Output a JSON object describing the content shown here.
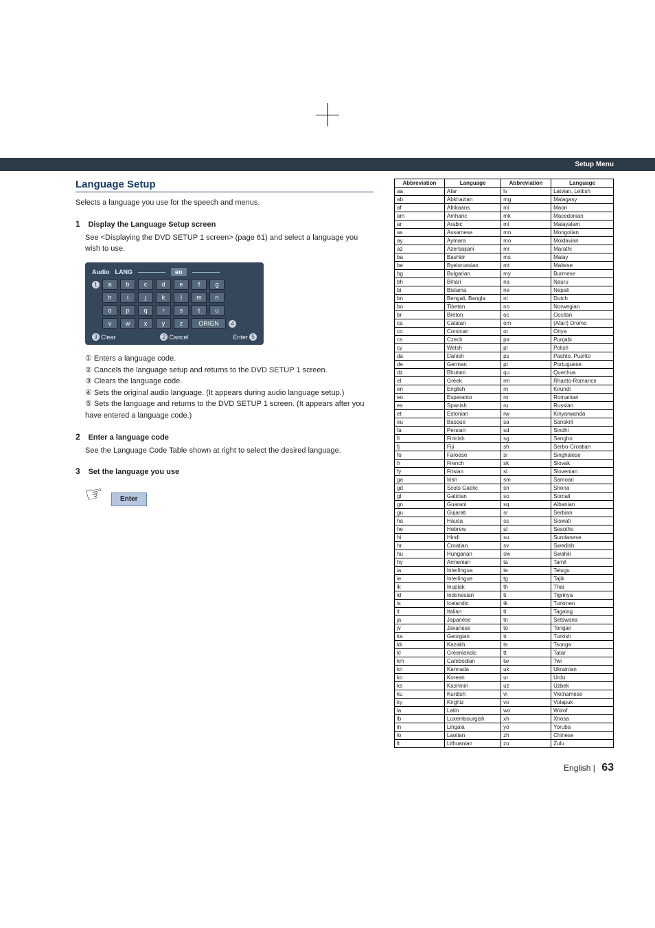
{
  "header_band": "Setup Menu",
  "section_title": "Language Setup",
  "intro": "Selects a language you use for the speech and menus.",
  "steps": {
    "1": {
      "title": "Display the Language Setup screen",
      "body": "See <Displaying the DVD SETUP 1 screen> (page 61) and select a language you wish to use."
    },
    "2": {
      "title": "Enter a language code",
      "body": "See the Language Code Table shown at right to select the desired language."
    },
    "3": {
      "title": "Set the language you use"
    }
  },
  "osd": {
    "title_left": "Audio",
    "title_right": "LANG",
    "en_badge": "en",
    "rows": [
      [
        "a",
        "b",
        "c",
        "d",
        "e",
        "f",
        "g"
      ],
      [
        "h",
        "i",
        "j",
        "k",
        "l",
        "m",
        "n"
      ],
      [
        "o",
        "p",
        "q",
        "r",
        "s",
        "t",
        "u"
      ],
      [
        "v",
        "w",
        "x",
        "y",
        "z",
        "ORIGN"
      ]
    ],
    "bottom": {
      "clear": "Clear",
      "cancel": "Cancel",
      "enter": "Enter"
    },
    "markers": {
      "a_row": "①",
      "orign": "④",
      "clear": "③",
      "cancel": "②",
      "enter": "⑤"
    }
  },
  "legend": [
    "① Enters a language code.",
    "② Cancels the language setup and returns to the DVD SETUP 1 screen.",
    "③ Clears the language code.",
    "④ Sets the original audio language. (It appears during audio language setup.)",
    "⑤ Sets the language and returns to the DVD SETUP 1 screen. (It appears after you have entered a language code.)"
  ],
  "enter_button": "Enter",
  "table_headers": {
    "abbr": "Abbreviation",
    "lang": "Language"
  },
  "languages_left": [
    [
      "aa",
      "Afar"
    ],
    [
      "ab",
      "Abkhazian"
    ],
    [
      "af",
      "Afrikaans"
    ],
    [
      "am",
      "Amharic"
    ],
    [
      "ar",
      "Arabic"
    ],
    [
      "as",
      "Assamese"
    ],
    [
      "ay",
      "Aymara"
    ],
    [
      "az",
      "Azerbaijani"
    ],
    [
      "ba",
      "Bashkir"
    ],
    [
      "be",
      "Byelorussian"
    ],
    [
      "bg",
      "Bulgarian"
    ],
    [
      "bh",
      "Bihari"
    ],
    [
      "bi",
      "Bislama"
    ],
    [
      "bn",
      "Bengali, Bangla"
    ],
    [
      "bo",
      "Tibetan"
    ],
    [
      "br",
      "Breton"
    ],
    [
      "ca",
      "Catalan"
    ],
    [
      "co",
      "Corsican"
    ],
    [
      "cs",
      "Czech"
    ],
    [
      "cy",
      "Welsh"
    ],
    [
      "da",
      "Danish"
    ],
    [
      "de",
      "German"
    ],
    [
      "dz",
      "Bhutani"
    ],
    [
      "el",
      "Greek"
    ],
    [
      "en",
      "English"
    ],
    [
      "eo",
      "Esperanto"
    ],
    [
      "es",
      "Spanish"
    ],
    [
      "et",
      "Estonian"
    ],
    [
      "eu",
      "Basque"
    ],
    [
      "fa",
      "Persian"
    ],
    [
      "fi",
      "Finnish"
    ],
    [
      "fj",
      "Fiji"
    ],
    [
      "fo",
      "Faroese"
    ],
    [
      "fr",
      "French"
    ],
    [
      "fy",
      "Frisian"
    ],
    [
      "ga",
      "Irish"
    ],
    [
      "gd",
      "Scots Gaelic"
    ],
    [
      "gl",
      "Galician"
    ],
    [
      "gn",
      "Guarani"
    ],
    [
      "gu",
      "Gujarati"
    ],
    [
      "ha",
      "Hausa"
    ],
    [
      "he",
      "Hebrew"
    ],
    [
      "hi",
      "Hindi"
    ],
    [
      "hr",
      "Croatian"
    ],
    [
      "hu",
      "Hungarian"
    ],
    [
      "hy",
      "Armenian"
    ],
    [
      "ia",
      "Interlingua"
    ],
    [
      "ie",
      "Interlingue"
    ],
    [
      "ik",
      "Inupiak"
    ],
    [
      "id",
      "Indonesian"
    ],
    [
      "is",
      "Icelandic"
    ],
    [
      "it",
      "Italian"
    ],
    [
      "ja",
      "Japanese"
    ],
    [
      "jv",
      "Javanese"
    ],
    [
      "ka",
      "Georgian"
    ],
    [
      "kk",
      "Kazakh"
    ],
    [
      "kl",
      "Greenlandic"
    ],
    [
      "km",
      "Cambodian"
    ],
    [
      "kn",
      "Kannada"
    ],
    [
      "ko",
      "Korean"
    ],
    [
      "ks",
      "Kashmiri"
    ],
    [
      "ku",
      "Kurdish"
    ],
    [
      "ky",
      "Kirghiz"
    ],
    [
      "la",
      "Latin"
    ],
    [
      "lb",
      "Luxembourgish"
    ],
    [
      "ln",
      "Lingala"
    ],
    [
      "lo",
      "Laotian"
    ],
    [
      "lt",
      "Lithuanian"
    ]
  ],
  "languages_right": [
    [
      "lv",
      "Latvian, Lettish"
    ],
    [
      "mg",
      "Malagasy"
    ],
    [
      "mi",
      "Maori"
    ],
    [
      "mk",
      "Macedonian"
    ],
    [
      "ml",
      "Malayalam"
    ],
    [
      "mn",
      "Mongolian"
    ],
    [
      "mo",
      "Moldavian"
    ],
    [
      "mr",
      "Marathi"
    ],
    [
      "ms",
      "Malay"
    ],
    [
      "mt",
      "Maltese"
    ],
    [
      "my",
      "Burmese"
    ],
    [
      "na",
      "Nauru"
    ],
    [
      "ne",
      "Nepali"
    ],
    [
      "nl",
      "Dutch"
    ],
    [
      "no",
      "Norwegian"
    ],
    [
      "oc",
      "Occitan"
    ],
    [
      "om",
      "(Afan) Oromo"
    ],
    [
      "or",
      "Oriya"
    ],
    [
      "pa",
      "Punjabi"
    ],
    [
      "pl",
      "Polish"
    ],
    [
      "ps",
      "Pashto, Pushto"
    ],
    [
      "pt",
      "Portuguese"
    ],
    [
      "qu",
      "Quechua"
    ],
    [
      "rm",
      "Rhaeto-Romance"
    ],
    [
      "rn",
      "Kirundi"
    ],
    [
      "ro",
      "Romanian"
    ],
    [
      "ru",
      "Russian"
    ],
    [
      "rw",
      "Kinyarwanda"
    ],
    [
      "sa",
      "Sanskrit"
    ],
    [
      "sd",
      "Sindhi"
    ],
    [
      "sg",
      "Sangho"
    ],
    [
      "sh",
      "Serbo-Croatian"
    ],
    [
      "si",
      "Singhalese"
    ],
    [
      "sk",
      "Slovak"
    ],
    [
      "sl",
      "Slovenian"
    ],
    [
      "sm",
      "Samoan"
    ],
    [
      "sn",
      "Shona"
    ],
    [
      "so",
      "Somali"
    ],
    [
      "sq",
      "Albanian"
    ],
    [
      "sr",
      "Serbian"
    ],
    [
      "ss",
      "Siswati"
    ],
    [
      "st",
      "Sesotho"
    ],
    [
      "su",
      "Sundanese"
    ],
    [
      "sv",
      "Swedish"
    ],
    [
      "sw",
      "Swahili"
    ],
    [
      "ta",
      "Tamil"
    ],
    [
      "te",
      "Telugu"
    ],
    [
      "tg",
      "Tajik"
    ],
    [
      "th",
      "Thai"
    ],
    [
      "ti",
      "Tigrinya"
    ],
    [
      "tk",
      "Turkmen"
    ],
    [
      "tl",
      "Tagalog"
    ],
    [
      "tn",
      "Setswana"
    ],
    [
      "to",
      "Tongan"
    ],
    [
      "tr",
      "Turkish"
    ],
    [
      "ts",
      "Tsonga"
    ],
    [
      "tt",
      "Tatar"
    ],
    [
      "tw",
      "Twi"
    ],
    [
      "uk",
      "Ukrainian"
    ],
    [
      "ur",
      "Urdu"
    ],
    [
      "uz",
      "Uzbek"
    ],
    [
      "vi",
      "Vietnamese"
    ],
    [
      "vo",
      "Volapuk"
    ],
    [
      "wo",
      "Wolof"
    ],
    [
      "xh",
      "Xhosa"
    ],
    [
      "yo",
      "Yoruba"
    ],
    [
      "zh",
      "Chinese"
    ],
    [
      "zu",
      "Zulu"
    ]
  ],
  "footer": {
    "lang": "English",
    "sep": "|",
    "page": "63"
  }
}
